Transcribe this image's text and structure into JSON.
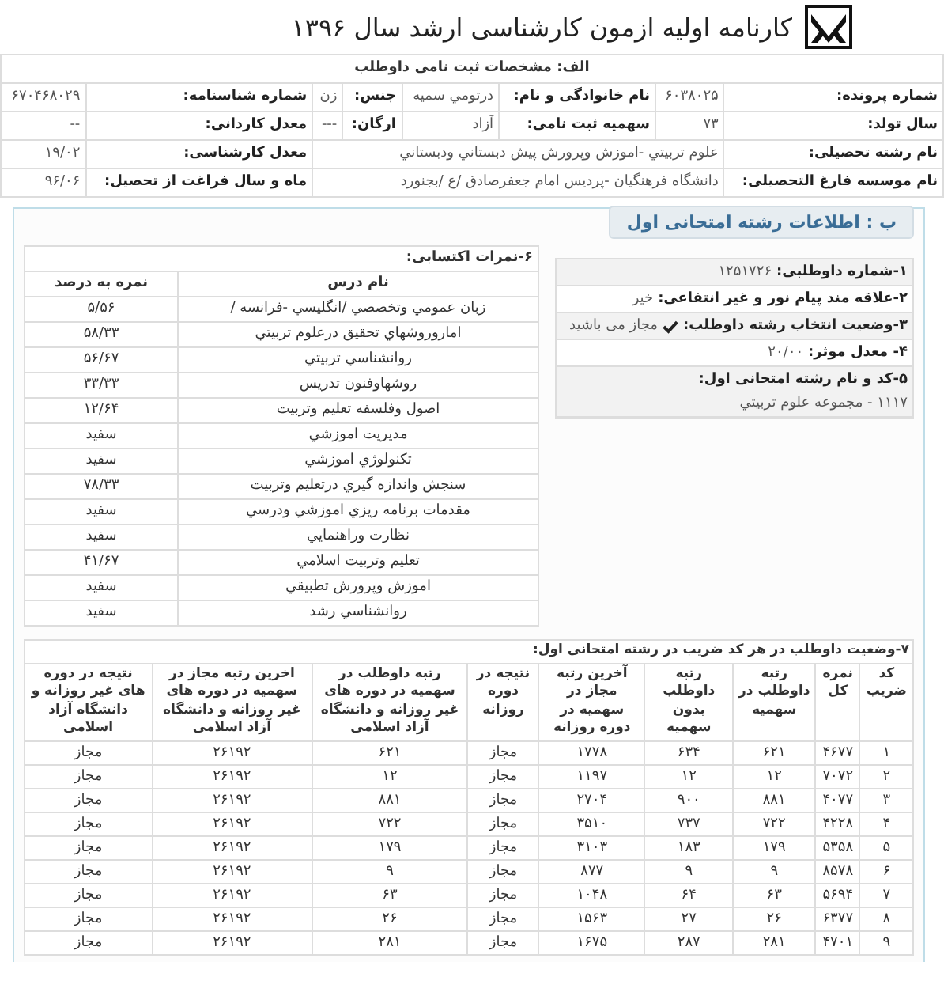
{
  "header": {
    "title": "کارنامه اولیه ازمون کارشناسی ارشد سال ۱۳۹۶"
  },
  "registration": {
    "title": "الف: مشخصات ثبت نامی داوطلب",
    "rows": [
      [
        {
          "label": "شماره پرونده:",
          "value": "۶۰۳۸۰۲۵"
        },
        {
          "label": "نام خانوادگی و نام:",
          "value": "درتومي سميه"
        },
        {
          "label": "جنس:",
          "value": "زن"
        },
        {
          "label": "شماره شناسنامه:",
          "value": "۶۷۰۴۶۸۰۲۹"
        }
      ],
      [
        {
          "label": "سال تولد:",
          "value": "۷۳"
        },
        {
          "label": "سهمیه ثبت نامی:",
          "value": "آزاد"
        },
        {
          "label": "ارگان:",
          "value": "---"
        },
        {
          "label": "معدل کاردانی:",
          "value": "--"
        }
      ],
      [
        {
          "label": "نام رشته تحصیلی:",
          "value": "علوم تربيتي -اموزش وپرورش پيش دبستاني ودبستاني"
        },
        {
          "label": "معدل کارشناسی:",
          "value": "۱۹/۰۲"
        }
      ],
      [
        {
          "label": "نام موسسه فارغ التحصیلی:",
          "value": "دانشگاه فرهنگيان -پرديس امام جعفرصادق /ع /بجنورد"
        },
        {
          "label": "ماه و سال فراغت از تحصیل:",
          "value": "۹۶/۰۶"
        }
      ]
    ]
  },
  "exam": {
    "legend": "ب : اطلاعات رشته امتحانی اول",
    "info": [
      {
        "kind": "text",
        "label": "۱-شماره داوطلبی:",
        "value": "۱۲۵۱۷۲۶"
      },
      {
        "kind": "text",
        "label": "۲-علاقه مند پیام نور و غیر انتفاعی:",
        "value": "خیر"
      },
      {
        "kind": "check",
        "label": "۳-وضعیت انتخاب رشته داوطلب:",
        "value": "مجاز می باشید"
      },
      {
        "kind": "text",
        "label": "۴- معدل موثر:",
        "value": "۲۰/۰۰"
      },
      {
        "kind": "block",
        "label": "۵-کد و نام رشته امتحانی اول:",
        "value": "۱۱۱۷ - مجموعه علوم تربيتي"
      }
    ],
    "grades": {
      "title": "۶-نمرات اکتسابی:",
      "columns": [
        "نام درس",
        "نمره به درصد"
      ],
      "rows": [
        [
          "زبان عمومي وتخصصي /انگليسي -فرانسه /",
          "۵/۵۶"
        ],
        [
          "اماروروشهاي تحقيق درعلوم تربيتي",
          "۵۸/۳۳"
        ],
        [
          "روانشناسي تربيتي",
          "۵۶/۶۷"
        ],
        [
          "روشهاوفنون تدريس",
          "۳۳/۳۳"
        ],
        [
          "اصول وفلسفه تعليم وتربيت",
          "۱۲/۶۴"
        ],
        [
          "مديريت اموزشي",
          "سفید"
        ],
        [
          "تكنولوژي اموزشي",
          "سفید"
        ],
        [
          "سنجش واندازه گيري درتعليم وتربيت",
          "۷۸/۳۳"
        ],
        [
          "مقدمات برنامه ريزي اموزشي ودرسي",
          "سفید"
        ],
        [
          "نظارت وراهنمايي",
          "سفید"
        ],
        [
          "تعليم وتربيت اسلامي",
          "۴۱/۶۷"
        ],
        [
          "اموزش وپرورش تطبيقي",
          "سفید"
        ],
        [
          "روانشناسي رشد",
          "سفید"
        ]
      ]
    },
    "status": {
      "title": "۷-وضعیت داوطلب در هر کد ضریب در رشته امتحانی اول:",
      "columns": [
        "کد ضریب",
        "نمره کل",
        "رتبه داوطلب در سهمیه",
        "رتبه داوطلب بدون سهمیه",
        "آخرین رتبه مجاز در سهمیه در دوره روزانه",
        "نتیجه در دوره روزانه",
        "رتبه داوطلب در سهمیه در دوره های غیر روزانه و دانشگاه آزاد اسلامی",
        "اخرین رتبه مجاز در سهمیه در دوره های غیر روزانه و دانشگاه آزاد اسلامی",
        "نتیجه در دوره های غیر روزانه و دانشگاه آزاد اسلامی"
      ],
      "rows": [
        [
          "۱",
          "۴۶۷۷",
          "۶۲۱",
          "۶۳۴",
          "۱۷۷۸",
          "مجاز",
          "۶۲۱",
          "۲۶۱۹۲",
          "مجاز"
        ],
        [
          "۲",
          "۷۰۷۲",
          "۱۲",
          "۱۲",
          "۱۱۹۷",
          "مجاز",
          "۱۲",
          "۲۶۱۹۲",
          "مجاز"
        ],
        [
          "۳",
          "۴۰۷۷",
          "۸۸۱",
          "۹۰۰",
          "۲۷۰۴",
          "مجاز",
          "۸۸۱",
          "۲۶۱۹۲",
          "مجاز"
        ],
        [
          "۴",
          "۴۲۲۸",
          "۷۲۲",
          "۷۳۷",
          "۳۵۱۰",
          "مجاز",
          "۷۲۲",
          "۲۶۱۹۲",
          "مجاز"
        ],
        [
          "۵",
          "۵۳۵۸",
          "۱۷۹",
          "۱۸۳",
          "۳۱۰۳",
          "مجاز",
          "۱۷۹",
          "۲۶۱۹۲",
          "مجاز"
        ],
        [
          "۶",
          "۸۵۷۸",
          "۹",
          "۹",
          "۸۷۷",
          "مجاز",
          "۹",
          "۲۶۱۹۲",
          "مجاز"
        ],
        [
          "۷",
          "۵۶۹۴",
          "۶۳",
          "۶۴",
          "۱۰۴۸",
          "مجاز",
          "۶۳",
          "۲۶۱۹۲",
          "مجاز"
        ],
        [
          "۸",
          "۶۳۷۷",
          "۲۶",
          "۲۷",
          "۱۵۶۳",
          "مجاز",
          "۲۶",
          "۲۶۱۹۲",
          "مجاز"
        ],
        [
          "۹",
          "۴۷۰۱",
          "۲۸۱",
          "۲۸۷",
          "۱۶۷۵",
          "مجاز",
          "۲۸۱",
          "۲۶۱۹۲",
          "مجاز"
        ]
      ]
    }
  }
}
